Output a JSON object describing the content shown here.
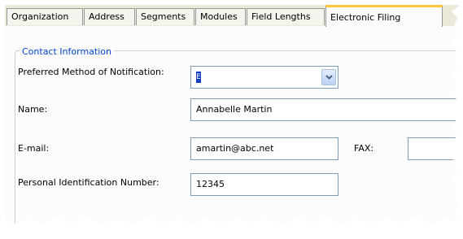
{
  "tabs": [
    {
      "label": "Organization",
      "active": false
    },
    {
      "label": "Address",
      "active": false
    },
    {
      "label": "Segments",
      "active": false
    },
    {
      "label": "Modules",
      "active": false
    },
    {
      "label": "Field Lengths",
      "active": false
    },
    {
      "label": "Electronic Filing",
      "active": true
    }
  ],
  "group": {
    "legend": "Contact Information"
  },
  "fields": {
    "notification": {
      "label": "Preferred Method of Notification:",
      "value": "E"
    },
    "name": {
      "label": "Name:",
      "value": "Annabelle Martin"
    },
    "email": {
      "label": "E-mail:",
      "value": "amartin@abc.net"
    },
    "fax": {
      "label": "FAX:",
      "value": ""
    },
    "pin": {
      "label": "Personal Identification Number:",
      "value": "12345"
    }
  },
  "colors": {
    "active_tab_accent": "#ffc83c",
    "legend_text": "#0046d5",
    "panel_bg": "#fcfcfe"
  }
}
